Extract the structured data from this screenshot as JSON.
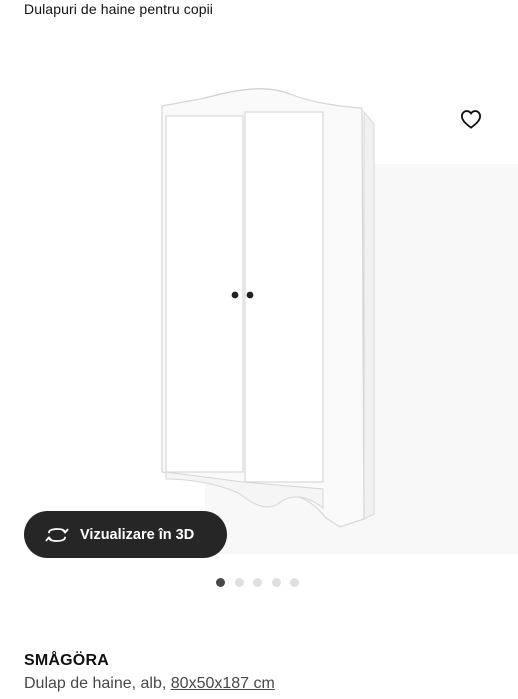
{
  "breadcrumb": {
    "label": "Dulapuri de haine pentru copii"
  },
  "gallery": {
    "icons": {
      "favourite": "heart-outline-icon",
      "view_3d": "rotate-3d-icon"
    },
    "view_3d_label": "Vizualizare în 3D",
    "image_count": 5,
    "active_index": 0
  },
  "product": {
    "name": "SMÅGÖRA",
    "description": "Dulap de haine, alb,",
    "size": "80x50x187 cm"
  },
  "colors": {
    "button_bg": "#262626",
    "dot_active": "#484848",
    "dot_inactive": "#dfdfdf",
    "text_secondary": "#484848"
  }
}
